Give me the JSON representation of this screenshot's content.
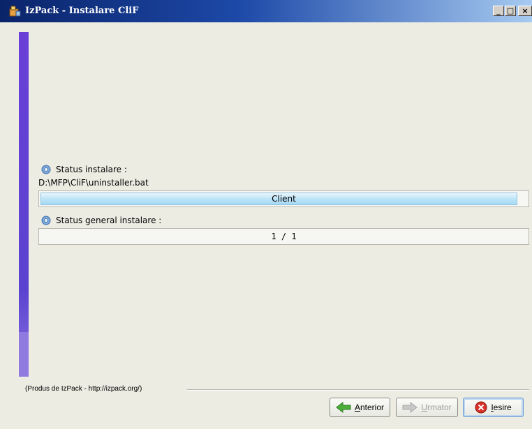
{
  "window": {
    "title": "IzPack - Instalare CliF"
  },
  "install_status": {
    "label": "Status instalare :",
    "current_file": "D:\\MFP\\CliF\\uninstaller.bat",
    "progress_text": "Client",
    "progress_fraction": 0.98
  },
  "general_status": {
    "label": "Status general instalare :",
    "progress_text": "1 / 1",
    "progress_fraction": 0.0
  },
  "footer": {
    "credit": "(Produs de IzPack - http://izpack.org/)",
    "buttons": {
      "previous": {
        "mnemonic": "A",
        "rest": "nterior",
        "enabled": true
      },
      "next": {
        "mnemonic": "U",
        "rest": "rmator",
        "enabled": false
      },
      "exit": {
        "mnemonic": "I",
        "rest": "esire",
        "enabled": true
      }
    }
  }
}
